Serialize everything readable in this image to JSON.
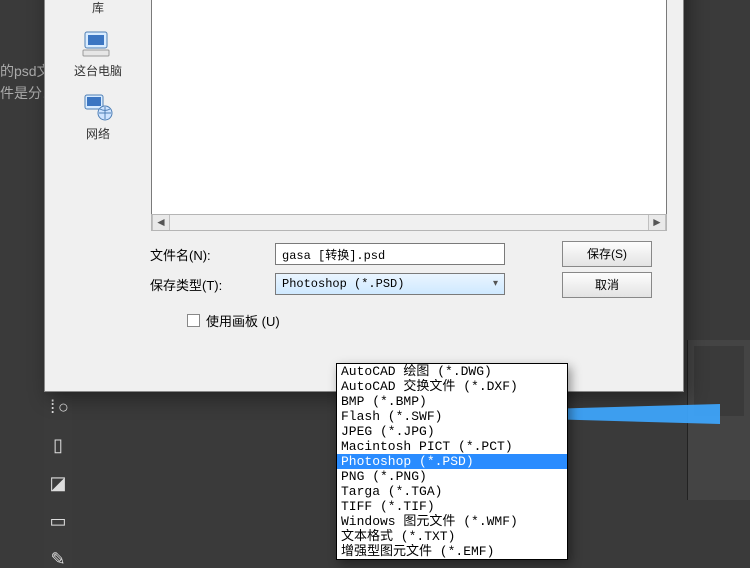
{
  "background": {
    "line1": "的psd文",
    "line2": "件是分…"
  },
  "places": [
    {
      "id": "library",
      "label": "库"
    },
    {
      "id": "computer",
      "label": "这台电脑"
    },
    {
      "id": "network",
      "label": "网络"
    }
  ],
  "form": {
    "filename_label": "文件名(N):",
    "filename_value": "gasa [转换].psd",
    "type_label": "保存类型(T):",
    "type_value": "Photoshop (*.PSD)",
    "use_artboard": "使用画板 (U)"
  },
  "buttons": {
    "save": "保存(S)",
    "cancel": "取消"
  },
  "filetype_options": [
    "AutoCAD 绘图 (*.DWG)",
    "AutoCAD 交换文件 (*.DXF)",
    "BMP (*.BMP)",
    "Flash (*.SWF)",
    "JPEG (*.JPG)",
    "Macintosh PICT (*.PCT)",
    "Photoshop (*.PSD)",
    "PNG (*.PNG)",
    "Targa (*.TGA)",
    "TIFF (*.TIF)",
    "Windows 图元文件 (*.WMF)",
    "文本格式 (*.TXT)",
    "增强型图元文件 (*.EMF)"
  ],
  "filetype_selected_index": 6,
  "icons": {
    "scroll_left": "◄",
    "scroll_right": "►",
    "caret": "▾"
  }
}
